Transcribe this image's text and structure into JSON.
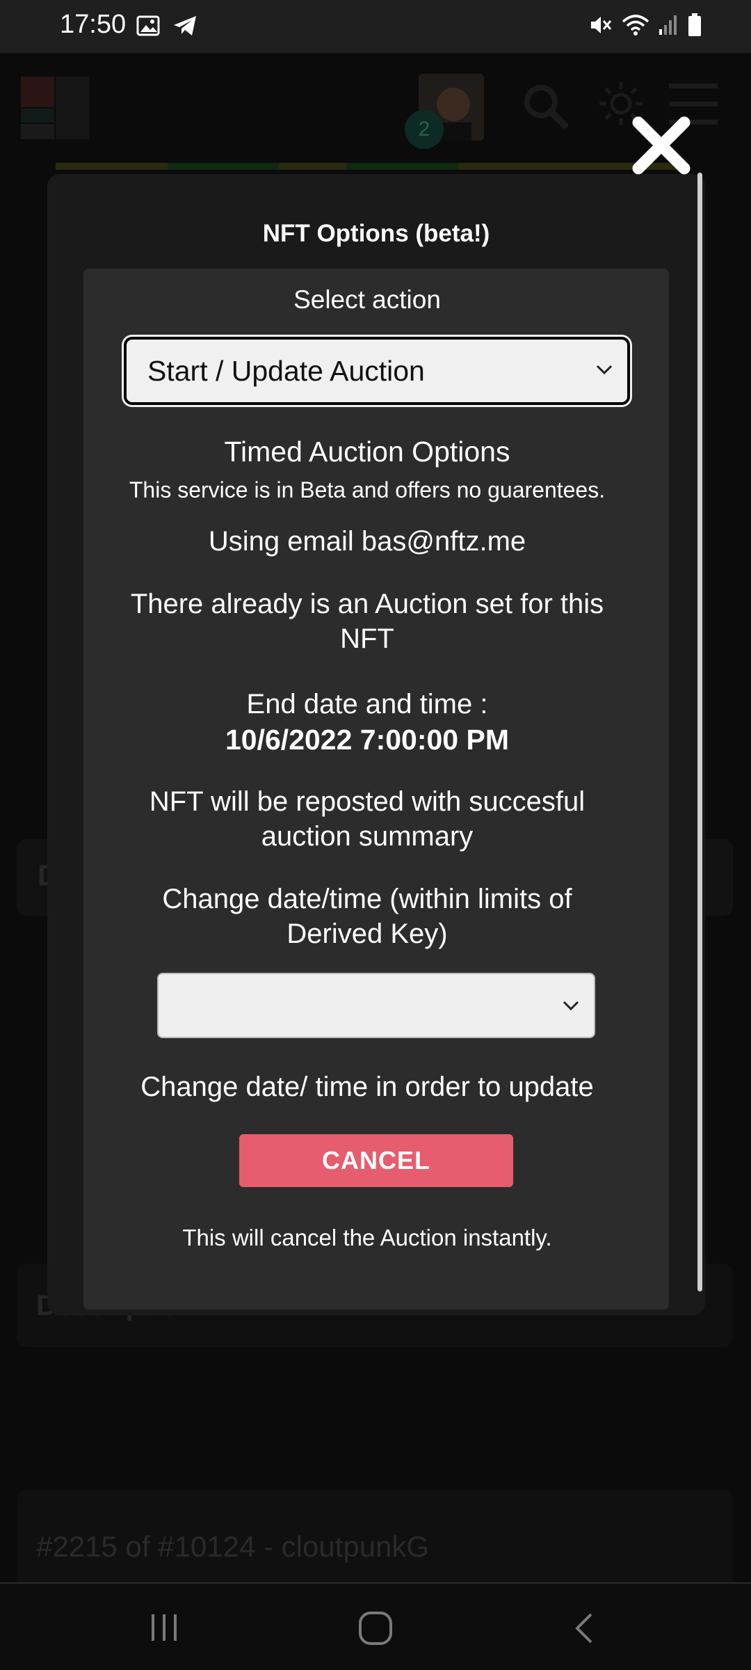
{
  "status_bar": {
    "time": "17:50",
    "left_icons": [
      "gallery-icon",
      "telegram-icon"
    ],
    "right_icons": [
      "mute-icon",
      "wifi-icon",
      "signal-icon",
      "battery-icon"
    ]
  },
  "background": {
    "avatar_badge": "2",
    "description_heading": "Description",
    "description_text": "#2215 of #10124 - cloutpunkG",
    "partial_label": "D",
    "progress_colors": [
      "#3a3a12",
      "#1a3a14",
      "#3a3a12",
      "#1a3a14",
      "#3a3a12",
      "#3a3a12"
    ]
  },
  "modal": {
    "title": "NFT Options (beta!)",
    "select_action_label": "Select action",
    "action_select_value": "Start / Update Auction",
    "section_title": "Timed Auction Options",
    "beta_notice": "This service is in Beta and offers no guarentees.",
    "email_line": "Using email bas@nftz.me",
    "existing_auction_line1": "There already is an Auction set for this",
    "existing_auction_line2": "NFT",
    "end_label": "End date and time :",
    "end_value": "10/6/2022 7:00:00 PM",
    "repost_line1": "NFT will be reposted with succesful",
    "repost_line2": "auction summary",
    "change_line1": "Change date/time (within limits of",
    "change_line2": "Derived Key)",
    "date_select_value": "",
    "update_hint": "Change date/ time in order to update",
    "cancel_button": "CANCEL",
    "cancel_note": "This will cancel the Auction instantly."
  },
  "nav_bar": {
    "buttons": [
      "recent-apps",
      "home",
      "back"
    ]
  },
  "colors": {
    "accent_cancel": "#e65d6f",
    "modal_bg": "#1a1a1a",
    "panel_bg": "#2c2c2c"
  }
}
